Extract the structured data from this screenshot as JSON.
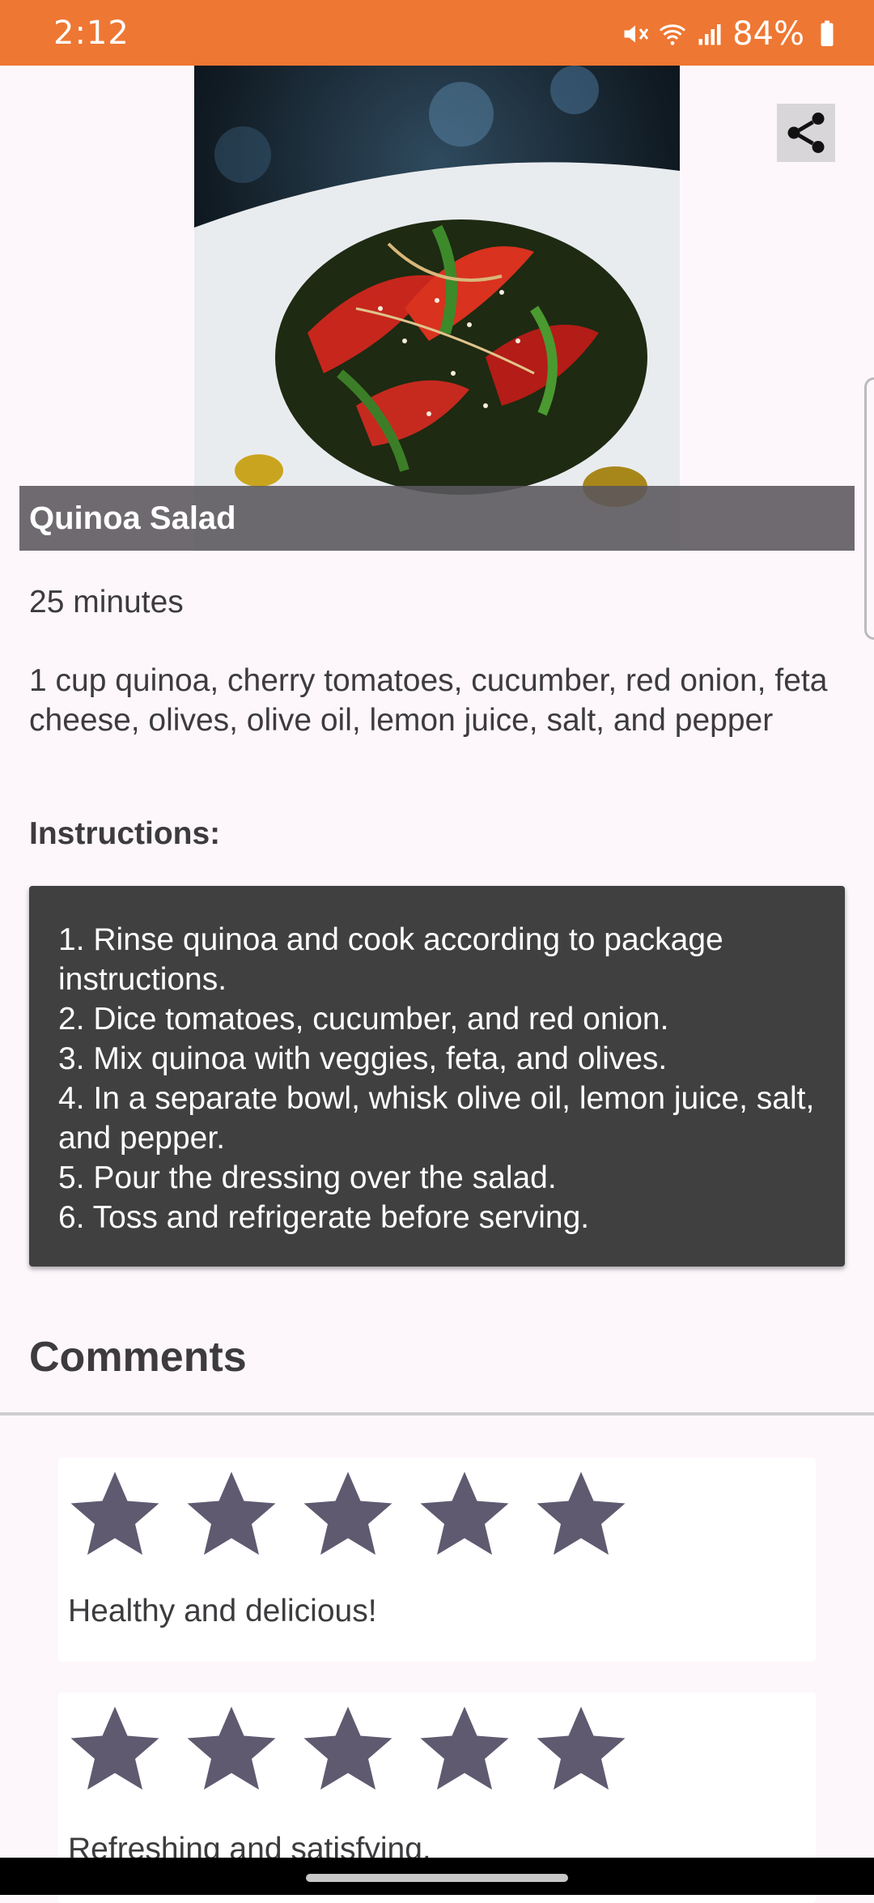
{
  "status_bar": {
    "time": "2:12",
    "battery": "84%",
    "icons": [
      "mute-icon",
      "wifi-icon",
      "signal-icon",
      "battery-icon"
    ],
    "color": "#ee7733"
  },
  "recipe": {
    "title": "Quinoa Salad",
    "duration": "25 minutes",
    "ingredients": "1 cup quinoa, cherry tomatoes, cucumber, red onion, feta cheese, olives, olive oil, lemon juice, salt, and pepper",
    "instructions_heading": "Instructions:",
    "instructions": [
      "1. Rinse quinoa and cook according to package instructions.",
      "2. Dice tomatoes, cucumber, and red onion.",
      "3. Mix quinoa with veggies, feta, and olives.",
      "4. In a separate bowl, whisk olive oil, lemon juice, salt, and pepper.",
      "5. Pour the dressing over the salad.",
      "6. Toss and refrigerate before serving."
    ]
  },
  "comments": {
    "heading": "Comments",
    "items": [
      {
        "rating": 5,
        "max_rating": 5,
        "text": "Healthy and delicious!"
      },
      {
        "rating": 5,
        "max_rating": 5,
        "text": "Refreshing and satisfying."
      }
    ]
  },
  "colors": {
    "star": "#5f5a70",
    "card_dark": "#404040",
    "background": "#fdf7fc"
  }
}
